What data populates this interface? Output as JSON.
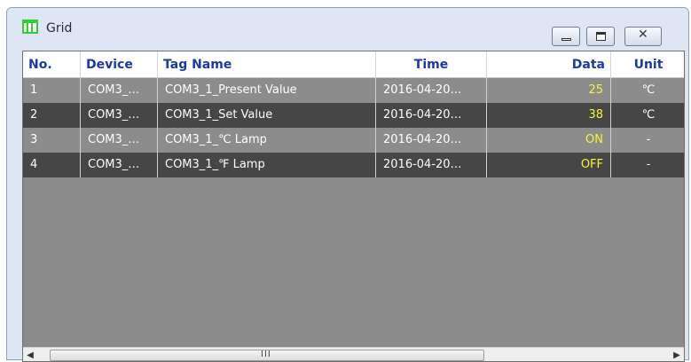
{
  "window": {
    "title": "Grid",
    "title_icon": "grid-window-icon",
    "controls": {
      "minimize": "minimize-icon",
      "maximize": "maximize-icon",
      "close": "✕"
    }
  },
  "table": {
    "columns": [
      "No.",
      "Device",
      "Tag Name",
      "Time",
      "Data",
      "Unit"
    ],
    "rows": [
      {
        "no": "1",
        "device": "COM3_…",
        "tag": "COM3_1_Present Value",
        "time": "2016-04-20…",
        "data": "25",
        "unit": "℃",
        "shade": "light"
      },
      {
        "no": "2",
        "device": "COM3_…",
        "tag": "COM3_1_Set Value",
        "time": "2016-04-20…",
        "data": "38",
        "unit": "℃",
        "shade": "dark"
      },
      {
        "no": "3",
        "device": "COM3_…",
        "tag": "COM3_1_℃ Lamp",
        "time": "2016-04-20…",
        "data": "ON",
        "unit": "-",
        "shade": "light"
      },
      {
        "no": "4",
        "device": "COM3_…",
        "tag": "COM3_1_℉ Lamp",
        "time": "2016-04-20…",
        "data": "OFF",
        "unit": "-",
        "shade": "dark"
      }
    ]
  },
  "scrollbar": {
    "left_arrow": "◀",
    "right_arrow": "▶",
    "grip": "III"
  },
  "colors": {
    "header_text": "#1c3aa6",
    "data_value": "#f5f53a",
    "row_light": "#8c8c8c",
    "row_dark": "#464646"
  }
}
